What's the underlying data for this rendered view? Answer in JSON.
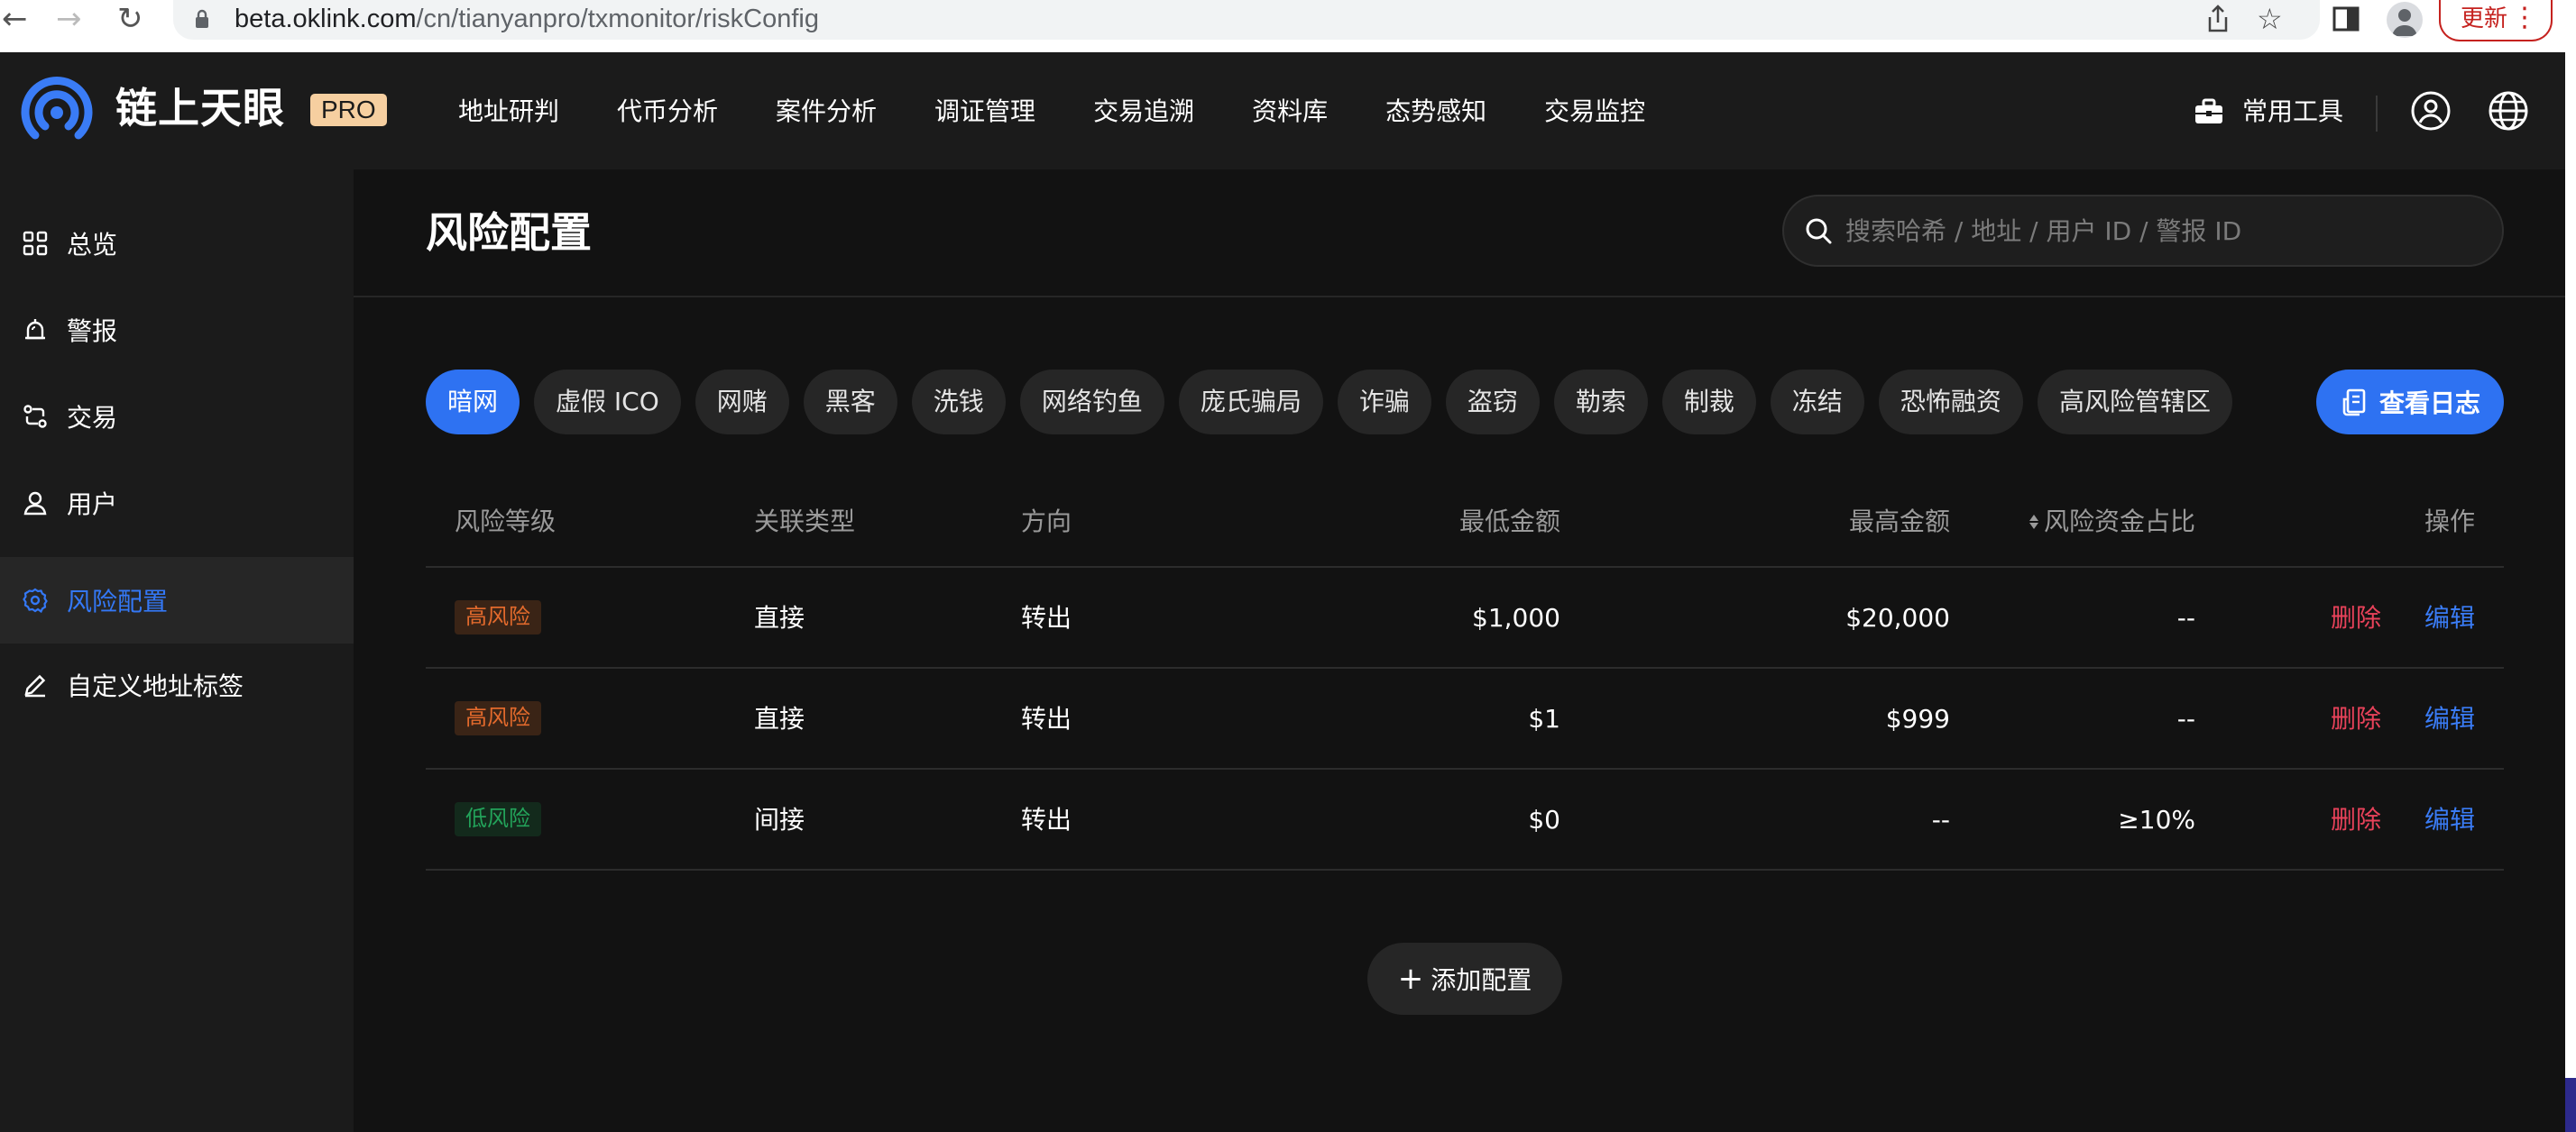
{
  "browser": {
    "url_host": "beta.oklink.com",
    "url_path": "/cn/tianyanpro/txmonitor/riskConfig",
    "update_label": "更新"
  },
  "brand": {
    "name": "链上天眼",
    "badge": "PRO"
  },
  "nav": {
    "items": [
      "地址研判",
      "代币分析",
      "案件分析",
      "调证管理",
      "交易追溯",
      "资料库",
      "态势感知",
      "交易监控"
    ],
    "tools_label": "常用工具"
  },
  "sidebar": {
    "items": [
      {
        "label": "总览",
        "icon": "overview-icon"
      },
      {
        "label": "警报",
        "icon": "alarm-icon"
      },
      {
        "label": "交易",
        "icon": "transaction-icon"
      },
      {
        "label": "用户",
        "icon": "user-icon"
      },
      {
        "label": "风险配置",
        "icon": "gear-icon",
        "active": true
      },
      {
        "label": "自定义地址标签",
        "icon": "pencil-icon"
      }
    ]
  },
  "page": {
    "title": "风险配置",
    "search_placeholder": "搜索哈希 / 地址 / 用户 ID / 警报 ID"
  },
  "tabs": {
    "items": [
      "暗网",
      "虚假 ICO",
      "网赌",
      "黑客",
      "洗钱",
      "网络钓鱼",
      "庞氏骗局",
      "诈骗",
      "盗窃",
      "勒索",
      "制裁",
      "冻结",
      "恐怖融资",
      "高风险管辖区"
    ],
    "active": "暗网",
    "log_button": "查看日志"
  },
  "table": {
    "headers": {
      "level": "风险等级",
      "type": "关联类型",
      "direction": "方向",
      "min": "最低金额",
      "max": "最高金额",
      "ratio": "风险资金占比",
      "actions": "操作"
    },
    "rows": [
      {
        "level": "高风险",
        "type": "直接",
        "direction": "转出",
        "min": "$1,000",
        "max": "$20,000",
        "ratio": "--",
        "delete": "删除",
        "edit": "编辑"
      },
      {
        "level": "高风险",
        "type": "直接",
        "direction": "转出",
        "min": "$1",
        "max": "$999",
        "ratio": "--",
        "delete": "删除",
        "edit": "编辑"
      },
      {
        "level": "低风险",
        "type": "间接",
        "direction": "转出",
        "min": "$0",
        "max": "--",
        "ratio": "≥10%",
        "delete": "删除",
        "edit": "编辑"
      }
    ]
  },
  "add_button": "添加配置",
  "colors": {
    "accent": "#2e72f2",
    "high_risk": "#e36a2c",
    "low_risk": "#23a35a",
    "delete": "#e8425a",
    "badge": "#f6cfa0"
  }
}
